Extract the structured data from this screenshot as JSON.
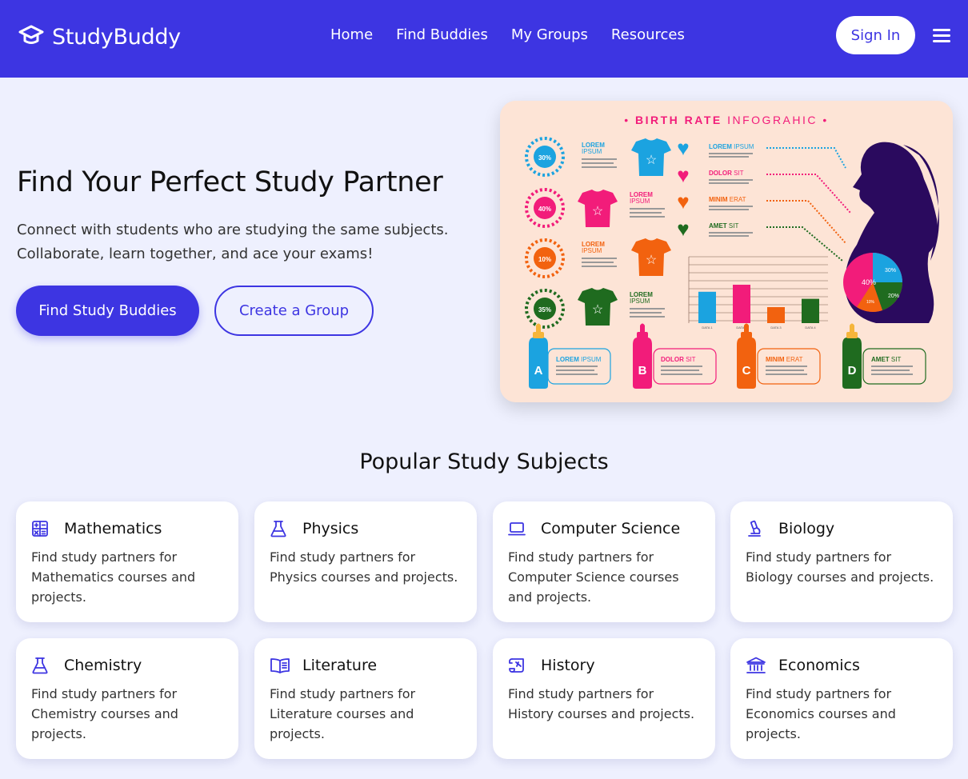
{
  "brand": {
    "name": "StudyBuddy",
    "icon": "graduation-cap-icon"
  },
  "nav": {
    "links": [
      "Home",
      "Find Buddies",
      "My Groups",
      "Resources"
    ],
    "signin_label": "Sign In",
    "menu_icon": "hamburger-menu-icon"
  },
  "hero": {
    "title": "Find Your Perfect Study Partner",
    "subtitle": "Connect with students who are studying the same subjects. Collaborate, learn together, and ace your exams!",
    "primary_button": "Find Study Buddies",
    "secondary_button": "Create a Group"
  },
  "infographic": {
    "title_bold": "BIRTH RATE",
    "title_light": "INFOGRAHIC",
    "percents": [
      "30%",
      "40%",
      "10%",
      "35%"
    ],
    "shirt_labels": [
      [
        "LOREM",
        "IPSUM"
      ],
      [
        "LOREM",
        "IPSUM"
      ],
      [
        "LOREM",
        "IPSUM"
      ],
      [
        "LOREM",
        "IPSUM"
      ]
    ],
    "legend": [
      {
        "bold": "LOREM",
        "light": "IPSUM"
      },
      {
        "bold": "DOLOR",
        "light": "SIT"
      },
      {
        "bold": "MINIM",
        "light": "ERAT"
      },
      {
        "bold": "AMET",
        "light": "SIT"
      }
    ],
    "bar_values": [
      49,
      60,
      25,
      38
    ],
    "bar_labels": [
      "DATA 1",
      "DATA 2",
      "DATA 3",
      "DATA 4"
    ],
    "pie_labels": [
      "40%",
      "30%",
      "20%",
      "10%"
    ],
    "bottles": [
      {
        "letter": "A",
        "bold": "LOREM",
        "light": "IPSUM"
      },
      {
        "letter": "B",
        "bold": "DOLOR",
        "light": "SIT"
      },
      {
        "letter": "C",
        "bold": "MINIM",
        "light": "ERAT"
      },
      {
        "letter": "D",
        "bold": "AMET",
        "light": "SIT"
      }
    ],
    "colors": {
      "blue": "#1ba3e0",
      "pink": "#f21c7a",
      "orange": "#f2620f",
      "green": "#1f6b1f",
      "silhouette": "#2a0a5e",
      "background": "#fde4d6"
    }
  },
  "subjects": {
    "title": "Popular Study Subjects",
    "cards": [
      {
        "name": "Mathematics",
        "icon": "calculator-icon",
        "desc": "Find study partners for Mathematics courses and projects."
      },
      {
        "name": "Physics",
        "icon": "flask-icon",
        "desc": "Find study partners for Physics courses and projects."
      },
      {
        "name": "Computer Science",
        "icon": "laptop-icon",
        "desc": "Find study partners for Computer Science courses and projects."
      },
      {
        "name": "Biology",
        "icon": "microscope-icon",
        "desc": "Find study partners for Biology courses and projects."
      },
      {
        "name": "Chemistry",
        "icon": "flask-icon",
        "desc": "Find study partners for Chemistry courses and projects."
      },
      {
        "name": "Literature",
        "icon": "book-icon",
        "desc": "Find study partners for Literature courses and projects."
      },
      {
        "name": "History",
        "icon": "scroll-icon",
        "desc": "Find study partners for History courses and projects."
      },
      {
        "name": "Economics",
        "icon": "bank-icon",
        "desc": "Find study partners for Economics courses and projects."
      }
    ]
  },
  "theme": {
    "primary": "#3d35e2",
    "page_bg": "#eef0fe"
  }
}
